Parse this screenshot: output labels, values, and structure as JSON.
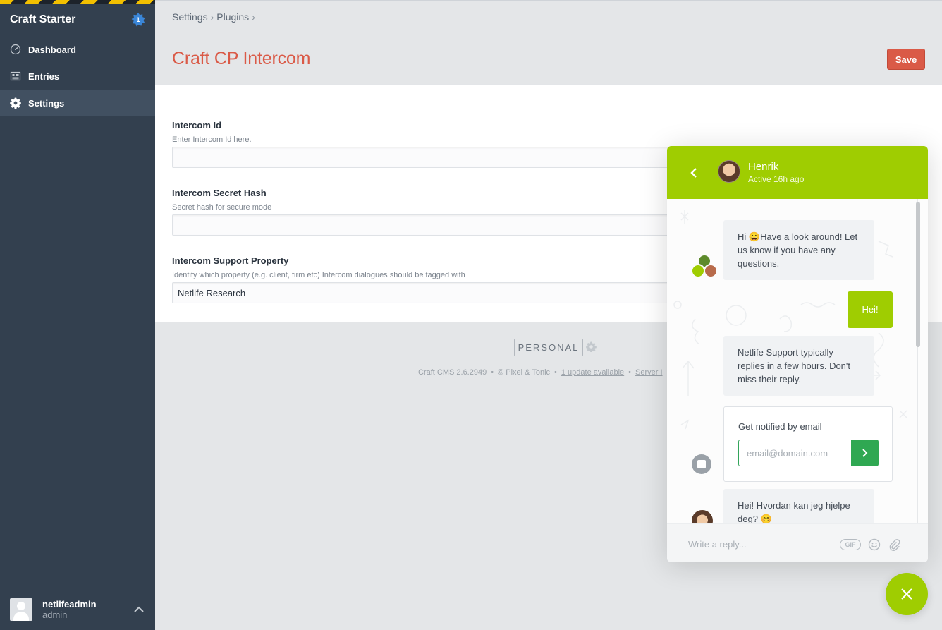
{
  "sidebar": {
    "site_name": "Craft Starter",
    "badge_count": "1",
    "items": [
      {
        "label": "Dashboard",
        "icon": "dashboard-gauge-icon"
      },
      {
        "label": "Entries",
        "icon": "entries-list-icon"
      },
      {
        "label": "Settings",
        "icon": "gear-icon",
        "active": true
      }
    ],
    "user": {
      "name": "netlifeadmin",
      "role": "admin"
    }
  },
  "breadcrumb": [
    "Settings",
    "Plugins"
  ],
  "page": {
    "title": "Craft CP Intercom",
    "save_label": "Save"
  },
  "fields": [
    {
      "label": "Intercom Id",
      "instructions": "Enter Intercom Id here.",
      "value": ""
    },
    {
      "label": "Intercom Secret Hash",
      "instructions": "Secret hash for secure mode",
      "value": ""
    },
    {
      "label": "Intercom Support Property",
      "instructions": "Identify which property (e.g. client, firm etc) Intercom dialogues should be tagged with",
      "value": "Netlife Research"
    }
  ],
  "footer": {
    "edition": "PERSONAL",
    "version": "Craft CMS 2.6.2949",
    "copyright": "© Pixel & Tonic",
    "update_link": "1 update available",
    "server_link": "Server I"
  },
  "messenger": {
    "agent_name": "Henrik",
    "agent_status": "Active 16h ago",
    "messages": [
      {
        "from": "team",
        "text": "Hi 😀Have a look around! Let us know if you have any questions."
      },
      {
        "from": "user",
        "text": "Hei!"
      },
      {
        "from": "bot",
        "text": "Netlife Support typically replies in a few hours. Don't miss their reply."
      },
      {
        "from": "agent",
        "text": "Hei! Hvordan kan jeg hjelpe deg? 😊"
      }
    ],
    "notify_title": "Get notified by email",
    "email_placeholder": "email@domain.com",
    "reply_placeholder": "Write a reply...",
    "gif_label": "GIF"
  },
  "colors": {
    "sidebar_bg": "#33404f",
    "accent_red": "#da5a47",
    "intercom_green": "#9fcd01",
    "submit_green": "#2fa852"
  }
}
